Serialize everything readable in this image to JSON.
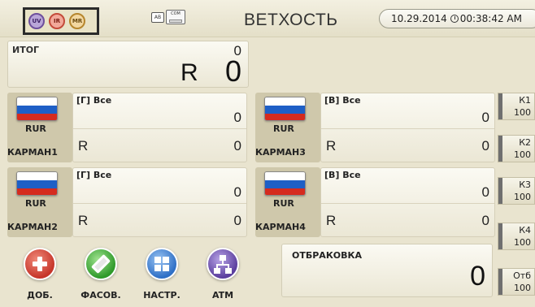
{
  "header": {
    "sensors": [
      {
        "label": "UV",
        "icon": "uv-sensor-icon",
        "color": "#6e4f9c"
      },
      {
        "label": "IR",
        "icon": "ir-sensor-icon",
        "color": "#c44b3a"
      },
      {
        "label": "MR",
        "icon": "mr-sensor-icon",
        "color": "#b6862d"
      }
    ],
    "mode_ab_label": "AB",
    "mode_com_label": "COM",
    "title": "ВЕТХОСТЬ",
    "date": "10.29.2014",
    "time": "00:38:42 AM"
  },
  "total": {
    "label": "ИТОГ",
    "count": "0",
    "currency_symbol": "R",
    "amount": "0"
  },
  "pockets": [
    {
      "name": "КАРМАН1",
      "currency": "RUR",
      "category": "[Г] Все",
      "count": "0",
      "currency_symbol": "R",
      "amount": "0",
      "flag": "russia-flag-icon"
    },
    {
      "name": "КАРМАН3",
      "currency": "RUR",
      "category": "[В] Все",
      "count": "0",
      "currency_symbol": "R",
      "amount": "0",
      "flag": "russia-flag-icon"
    },
    {
      "name": "КАРМАН2",
      "currency": "RUR",
      "category": "[Г] Все",
      "count": "0",
      "currency_symbol": "R",
      "amount": "0",
      "flag": "russia-flag-icon"
    },
    {
      "name": "КАРМАН4",
      "currency": "RUR",
      "category": "[В] Все",
      "count": "0",
      "currency_symbol": "R",
      "amount": "0",
      "flag": "russia-flag-icon"
    }
  ],
  "k_boxes": [
    {
      "label": "К1",
      "value": "100"
    },
    {
      "label": "К2",
      "value": "100"
    },
    {
      "label": "К3",
      "value": "100"
    },
    {
      "label": "К4",
      "value": "100"
    },
    {
      "label": "Отб",
      "value": "100"
    }
  ],
  "reject": {
    "label": "ОТБРАКОВКА",
    "count": "0"
  },
  "buttons": [
    {
      "label": "ДОБ.",
      "icon": "plus-icon",
      "color": "#c6352a"
    },
    {
      "label": "ФАСОВ.",
      "icon": "batch-icon",
      "color": "#2f9a2a"
    },
    {
      "label": "НАСТР.",
      "icon": "settings-gear-icon",
      "color": "#2e6fc6"
    },
    {
      "label": "ATM",
      "icon": "atm-network-icon",
      "color": "#5b3e9e"
    }
  ]
}
